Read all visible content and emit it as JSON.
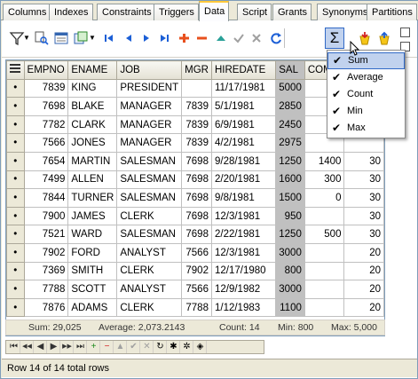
{
  "tabs": [
    "Columns",
    "Indexes",
    "Constraints",
    "Triggers",
    "Data",
    "Script",
    "Grants",
    "Synonyms",
    "Partitions"
  ],
  "active_tab": "Data",
  "columns": [
    "EMPNO",
    "ENAME",
    "JOB",
    "MGR",
    "HIREDATE",
    "SAL",
    "COM",
    ""
  ],
  "rows": [
    [
      "7839",
      "KING",
      "PRESIDENT",
      "",
      "11/17/1981",
      "5000",
      "",
      ""
    ],
    [
      "7698",
      "BLAKE",
      "MANAGER",
      "7839",
      "5/1/1981",
      "2850",
      "",
      ""
    ],
    [
      "7782",
      "CLARK",
      "MANAGER",
      "7839",
      "6/9/1981",
      "2450",
      "",
      ""
    ],
    [
      "7566",
      "JONES",
      "MANAGER",
      "7839",
      "4/2/1981",
      "2975",
      "",
      ""
    ],
    [
      "7654",
      "MARTIN",
      "SALESMAN",
      "7698",
      "9/28/1981",
      "1250",
      "1400",
      "30"
    ],
    [
      "7499",
      "ALLEN",
      "SALESMAN",
      "7698",
      "2/20/1981",
      "1600",
      "300",
      "30"
    ],
    [
      "7844",
      "TURNER",
      "SALESMAN",
      "7698",
      "9/8/1981",
      "1500",
      "0",
      "30"
    ],
    [
      "7900",
      "JAMES",
      "CLERK",
      "7698",
      "12/3/1981",
      "950",
      "",
      "30"
    ],
    [
      "7521",
      "WARD",
      "SALESMAN",
      "7698",
      "2/22/1981",
      "1250",
      "500",
      "30"
    ],
    [
      "7902",
      "FORD",
      "ANALYST",
      "7566",
      "12/3/1981",
      "3000",
      "",
      "20"
    ],
    [
      "7369",
      "SMITH",
      "CLERK",
      "7902",
      "12/17/1980",
      "800",
      "",
      "20"
    ],
    [
      "7788",
      "SCOTT",
      "ANALYST",
      "7566",
      "12/9/1982",
      "3000",
      "",
      "20"
    ],
    [
      "7876",
      "ADAMS",
      "CLERK",
      "7788",
      "1/12/1983",
      "1100",
      "",
      "20"
    ]
  ],
  "summary": {
    "sum": "Sum: 29,025",
    "average": "Average: 2,073.2143",
    "count": "Count: 14",
    "min": "Min: 800",
    "max": "Max: 5,000"
  },
  "aggregate_menu": {
    "items": [
      {
        "label": "Sum",
        "checked": true
      },
      {
        "label": "Average",
        "checked": true
      },
      {
        "label": "Count",
        "checked": true
      },
      {
        "label": "Min",
        "checked": true
      },
      {
        "label": "Max",
        "checked": true
      }
    ],
    "highlighted": "Sum",
    "check_glyph": "✔"
  },
  "status": "Row 14 of 14 total rows",
  "toolbar": {
    "sigma_label": "Σ"
  },
  "colors": {
    "highlight_column": "#c0c0c0",
    "menu_highlight": "#c1d2ee",
    "nav_blue": "#1c5fd6",
    "add_red": "#e8501e",
    "accent_green": "#2aa198"
  }
}
